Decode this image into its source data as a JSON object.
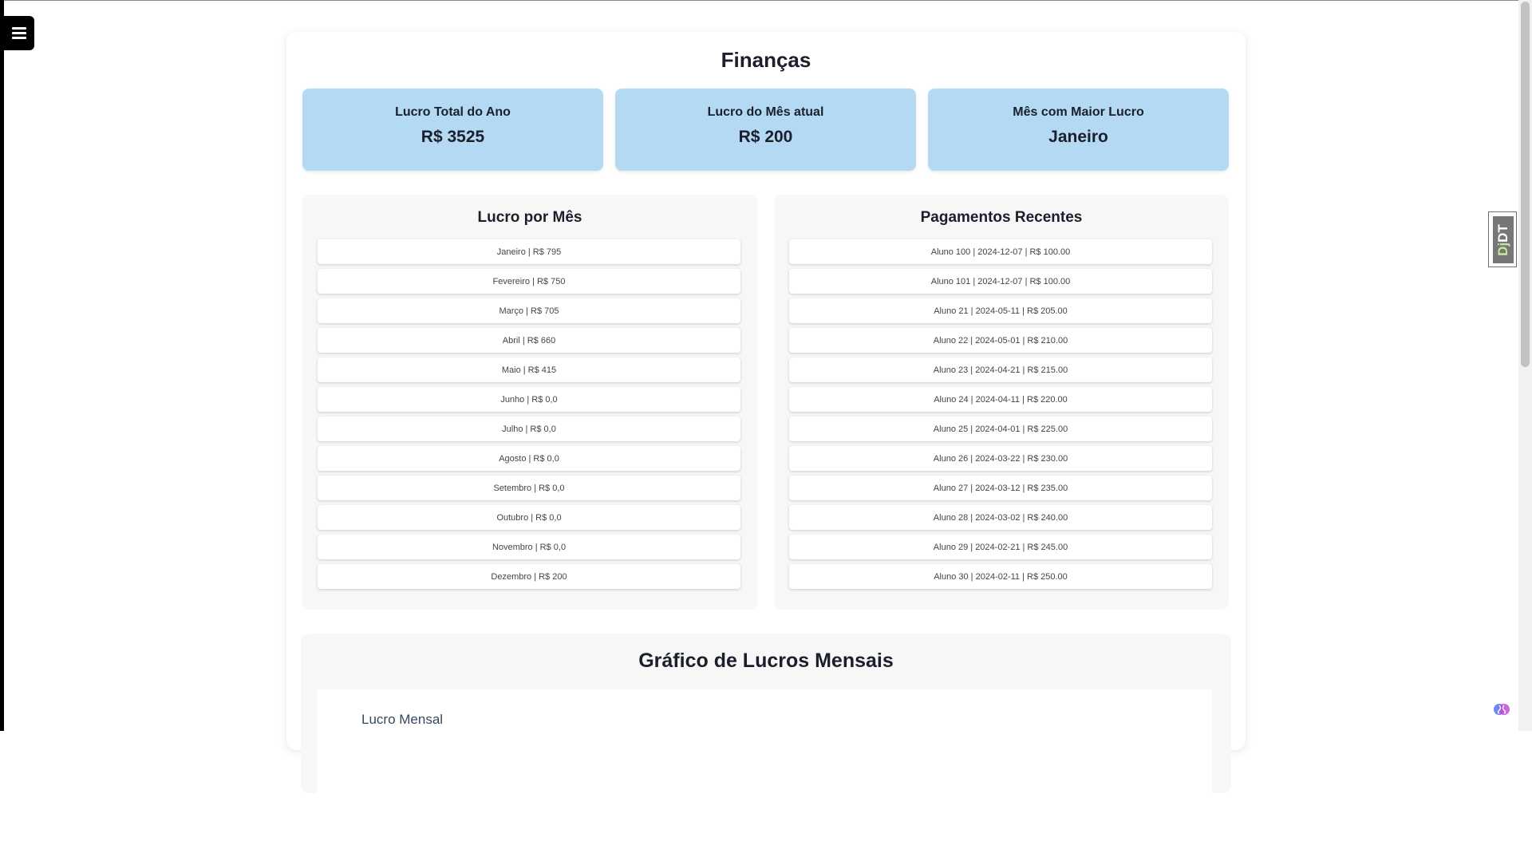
{
  "page": {
    "title": "Finanças"
  },
  "stats": [
    {
      "label": "Lucro Total do Ano",
      "value": "R$ 3525"
    },
    {
      "label": "Lucro do Mês atual",
      "value": "R$ 200"
    },
    {
      "label": "Mês com Maior Lucro",
      "value": "Janeiro"
    }
  ],
  "monthly": {
    "title": "Lucro por Mês",
    "items": [
      "Janeiro | R$ 795",
      "Fevereiro | R$ 750",
      "Março | R$ 705",
      "Abril | R$ 660",
      "Maio | R$ 415",
      "Junho | R$ 0,0",
      "Julho | R$ 0,0",
      "Agosto | R$ 0,0",
      "Setembro | R$ 0,0",
      "Outubro | R$ 0,0",
      "Novembro | R$ 0,0",
      "Dezembro | R$ 200"
    ]
  },
  "payments": {
    "title": "Pagamentos Recentes",
    "items": [
      "Aluno 100 | 2024-12-07 | R$ 100.00",
      "Aluno 101 | 2024-12-07 | R$ 100.00",
      "Aluno 21 | 2024-05-11 | R$ 205.00",
      "Aluno 22 | 2024-05-01 | R$ 210.00",
      "Aluno 23 | 2024-04-21 | R$ 215.00",
      "Aluno 24 | 2024-04-11 | R$ 220.00",
      "Aluno 25 | 2024-04-01 | R$ 225.00",
      "Aluno 26 | 2024-03-22 | R$ 230.00",
      "Aluno 27 | 2024-03-12 | R$ 235.00",
      "Aluno 28 | 2024-03-02 | R$ 240.00",
      "Aluno 29 | 2024-02-21 | R$ 245.00",
      "Aluno 30 | 2024-02-11 | R$ 250.00"
    ]
  },
  "chart": {
    "title": "Gráfico de Lucros Mensais",
    "legend": "Lucro Mensal"
  },
  "toolbar": {
    "djdt_label_dj": "Dj",
    "djdt_label_dt": "DT"
  },
  "icons": {
    "menu": "hamburger-menu-icon",
    "extension": "brain-icon"
  },
  "colors": {
    "stat_card_bg": "#b3daf2",
    "panel_bg": "#f7f7f7",
    "menu_bg": "#000000",
    "djdt_bg": "#777777",
    "djdt_accent": "#c6e6a0"
  }
}
